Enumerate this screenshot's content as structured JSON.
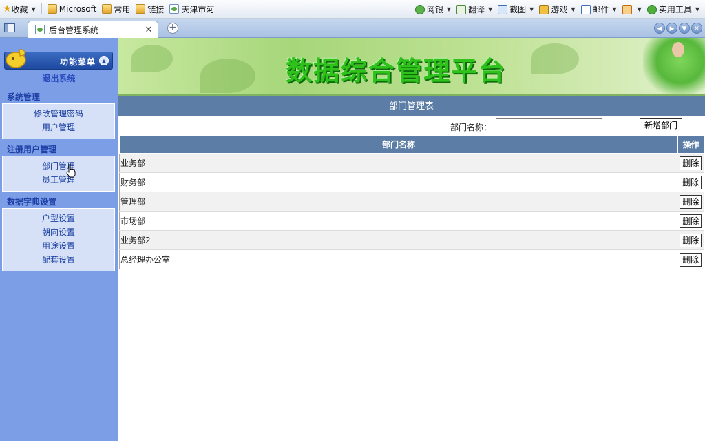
{
  "favbar": {
    "items": [
      {
        "label": "收藏",
        "icon": "star-icon"
      },
      {
        "label": "Microsoft",
        "icon": "folder-icon"
      },
      {
        "label": "常用",
        "icon": "folder-icon"
      },
      {
        "label": "链接",
        "icon": "folder-icon"
      },
      {
        "label": "天津市河",
        "icon": "page-icon"
      }
    ],
    "tools": [
      {
        "label": "网银",
        "icon": "bank-icon"
      },
      {
        "label": "翻译",
        "icon": "translate-icon"
      },
      {
        "label": "截图",
        "icon": "screenshot-icon"
      },
      {
        "label": "游戏",
        "icon": "game-icon"
      },
      {
        "label": "邮件",
        "icon": "mail-icon"
      },
      {
        "label": "",
        "icon": "calendar-icon"
      },
      {
        "label": "实用工具",
        "icon": "tools-icon"
      }
    ]
  },
  "tabs": {
    "active_title": "后台管理系统"
  },
  "sidebar": {
    "menu_title": "功能菜单",
    "logout": "退出系统",
    "sections": [
      {
        "title": "系统管理",
        "links": [
          "修改管理密码",
          "用户管理"
        ]
      },
      {
        "title": "注册用户管理",
        "links": [
          "部门管理",
          "员工管理"
        ]
      },
      {
        "title": "数据字典设置",
        "links": [
          "户型设置",
          "朝向设置",
          "用途设置",
          "配套设置"
        ]
      }
    ]
  },
  "banner": {
    "title": "数据综合管理平台"
  },
  "page": {
    "section_title": "部门管理表",
    "search_label": "部门名称：",
    "search_value": "",
    "add_button": "新增部门"
  },
  "table": {
    "headers": [
      "部门名称",
      "操作"
    ],
    "rows": [
      {
        "name": "业务部",
        "action": "删除"
      },
      {
        "name": "财务部",
        "action": "删除"
      },
      {
        "name": "管理部",
        "action": "删除"
      },
      {
        "name": "市场部",
        "action": "删除"
      },
      {
        "name": "业务部2",
        "action": "删除"
      },
      {
        "name": "总经理办公室",
        "action": "删除"
      }
    ]
  },
  "colors": {
    "sidebar_bg": "#7b9ee6",
    "header_bar": "#5c7ea6",
    "banner_title": "#2fc21b"
  }
}
